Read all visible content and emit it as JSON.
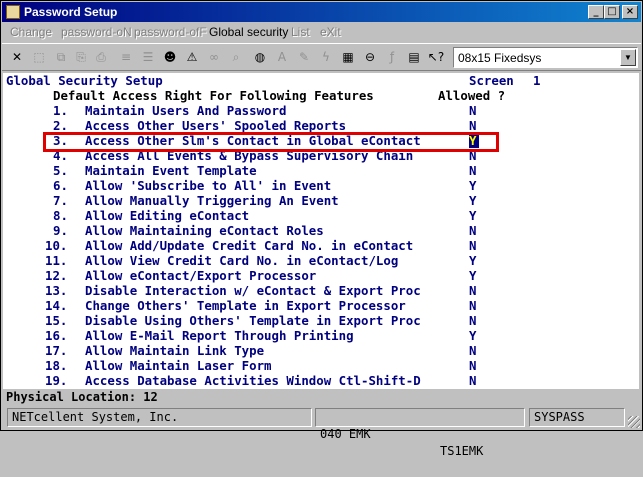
{
  "window": {
    "title": "Password Setup"
  },
  "title_buttons": {
    "minimize": "_",
    "maximize": "□",
    "close": "×"
  },
  "menu": {
    "change": "Change",
    "password_on": "password-oN",
    "password_off": "password-ofF",
    "global_security": "Global security",
    "list": "List",
    "exit": "eXit"
  },
  "toolbar": {
    "font_value": "08x15 Fixedsys",
    "icons": [
      "close-x-icon",
      "select-icon",
      "copy-icon",
      "paste-icon",
      "print-icon",
      "notes-icon",
      "list-icon",
      "user-icon",
      "warning-icon",
      "binoculars-icon",
      "search-icon",
      "globe-icon",
      "italic-icon",
      "edit-icon",
      "lightning-icon",
      "calc-icon",
      "link-icon",
      "function-icon",
      "book-icon",
      "help-pointer-icon"
    ]
  },
  "screen": {
    "header_left": "Global Security Setup",
    "header_right_label": "Screen",
    "screen_number": "1",
    "subheader": "Default Access Right For Following Features",
    "allowed_header": "Allowed ?",
    "rows": [
      {
        "num": "1.",
        "label": "Maintain Users And Password",
        "allowed": "N"
      },
      {
        "num": "2.",
        "label": "Access Other Users' Spooled Reports",
        "allowed": "N"
      },
      {
        "num": "3.",
        "label": "Access Other Slm's Contact in Global eContact",
        "allowed": "Y"
      },
      {
        "num": "4.",
        "label": "Access All Events & Bypass Supervisory Chain",
        "allowed": "N"
      },
      {
        "num": "5.",
        "label": "Maintain Event Template",
        "allowed": "N"
      },
      {
        "num": "6.",
        "label": "Allow 'Subscribe to All' in Event",
        "allowed": "Y"
      },
      {
        "num": "7.",
        "label": "Allow Manually Triggering An Event",
        "allowed": "Y"
      },
      {
        "num": "8.",
        "label": "Allow Editing eContact",
        "allowed": "Y"
      },
      {
        "num": "9.",
        "label": "Allow Maintaining eContact Roles",
        "allowed": "N"
      },
      {
        "num": "10.",
        "label": "Allow Add/Update Credit Card No. in eContact",
        "allowed": "N"
      },
      {
        "num": "11.",
        "label": "Allow View Credit Card No. in eContact/Log",
        "allowed": "Y"
      },
      {
        "num": "12.",
        "label": "Allow eContact/Export Processor",
        "allowed": "Y"
      },
      {
        "num": "13.",
        "label": "Disable Interaction w/ eContact & Export Proc",
        "allowed": "N"
      },
      {
        "num": "14.",
        "label": "Change Others' Template in Export Processor",
        "allowed": "N"
      },
      {
        "num": "15.",
        "label": "Disable Using Others' Template in Export Proc",
        "allowed": "N"
      },
      {
        "num": "16.",
        "label": "Allow E-Mail Report Through Printing",
        "allowed": "Y"
      },
      {
        "num": "17.",
        "label": "Allow Maintain Link Type",
        "allowed": "N"
      },
      {
        "num": "18.",
        "label": "Allow Maintain Laser Form",
        "allowed": "N"
      },
      {
        "num": "19.",
        "label": "Access Database Activities Window Ctl-Shift-D",
        "allowed": "N"
      }
    ],
    "physical_location": "Physical Location: 12"
  },
  "status": {
    "company": "NETcellent System, Inc.",
    "code": "040 EMK",
    "terminal": "TS1EMK",
    "program": "SYSPASS"
  }
}
